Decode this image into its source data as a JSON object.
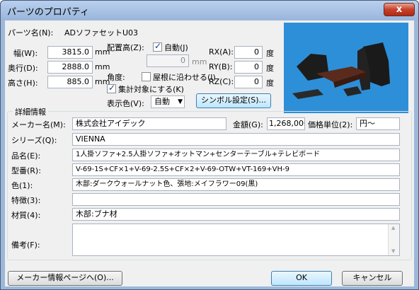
{
  "window": {
    "title": "パーツのプロパティ",
    "close_symbol": "x"
  },
  "parts_name": {
    "label": "パーツ名(N):",
    "value": "ADソファセットU03"
  },
  "size": {
    "width": {
      "label": "幅(W):",
      "value": "3815.0",
      "unit": "mm"
    },
    "depth": {
      "label": "奥行(D):",
      "value": "2888.0",
      "unit": "mm"
    },
    "height": {
      "label": "高さ(H):",
      "value": "885.0",
      "unit": "mm"
    }
  },
  "placement": {
    "label": "配置高(Z):",
    "auto_label": "自動(J)",
    "auto_checked": true,
    "value": "0",
    "unit": "mm"
  },
  "angle": {
    "label": "角度:",
    "roof_label": "屋根に沿わせる(I)",
    "roof_checked": false
  },
  "aggregate": {
    "label": "集計対象にする(K)",
    "checked": true
  },
  "display_color": {
    "label": "表示色(V):",
    "value": "自動",
    "arrow": "▼"
  },
  "symbol_button": {
    "label": "シンボル設定(S)..."
  },
  "rotation": {
    "rx": {
      "label": "RX(A):",
      "value": "0",
      "unit": "度"
    },
    "ry": {
      "label": "RY(B):",
      "value": "0",
      "unit": "度"
    },
    "rz": {
      "label": "RZ(C):",
      "value": "0",
      "unit": "度"
    }
  },
  "detail": {
    "group_title": "詳細情報",
    "maker": {
      "label": "メーカー名(M):",
      "value": "株式会社アイデック"
    },
    "price": {
      "label": "金額(G):",
      "value": "1,268,000"
    },
    "price_unit": {
      "label": "価格単位(2):",
      "value": "円～"
    },
    "series": {
      "label": "シリーズ(Q):",
      "value": "VIENNA"
    },
    "product": {
      "label": "品名(E):",
      "value": "1人掛ソファ+2.5人掛ソファ+オットマン+センターテーブル+テレビボード"
    },
    "model": {
      "label": "型番(R):",
      "value": "V-69-1S+CF×1+V-69-2.5S+CF×2+V-69-OTW+VT-169+VH-9"
    },
    "color": {
      "label": "色(1):",
      "value": "木部:ダークウォールナット色、張地:メイフラワー09(黒)"
    },
    "feature": {
      "label": "特徴(3):",
      "value": ""
    },
    "material": {
      "label": "材質(4):",
      "value": "木部:ブナ材"
    },
    "note": {
      "label": "備考(F):",
      "value": ""
    }
  },
  "buttons": {
    "maker_page": "メーカー情報ページへ(O)...",
    "ok": "OK",
    "cancel": "キャンセル"
  },
  "colors": {
    "preview_bg": "#2d8fd8",
    "title_bar": "#9ab6dc",
    "dialog_bg": "#f0f0f0"
  }
}
